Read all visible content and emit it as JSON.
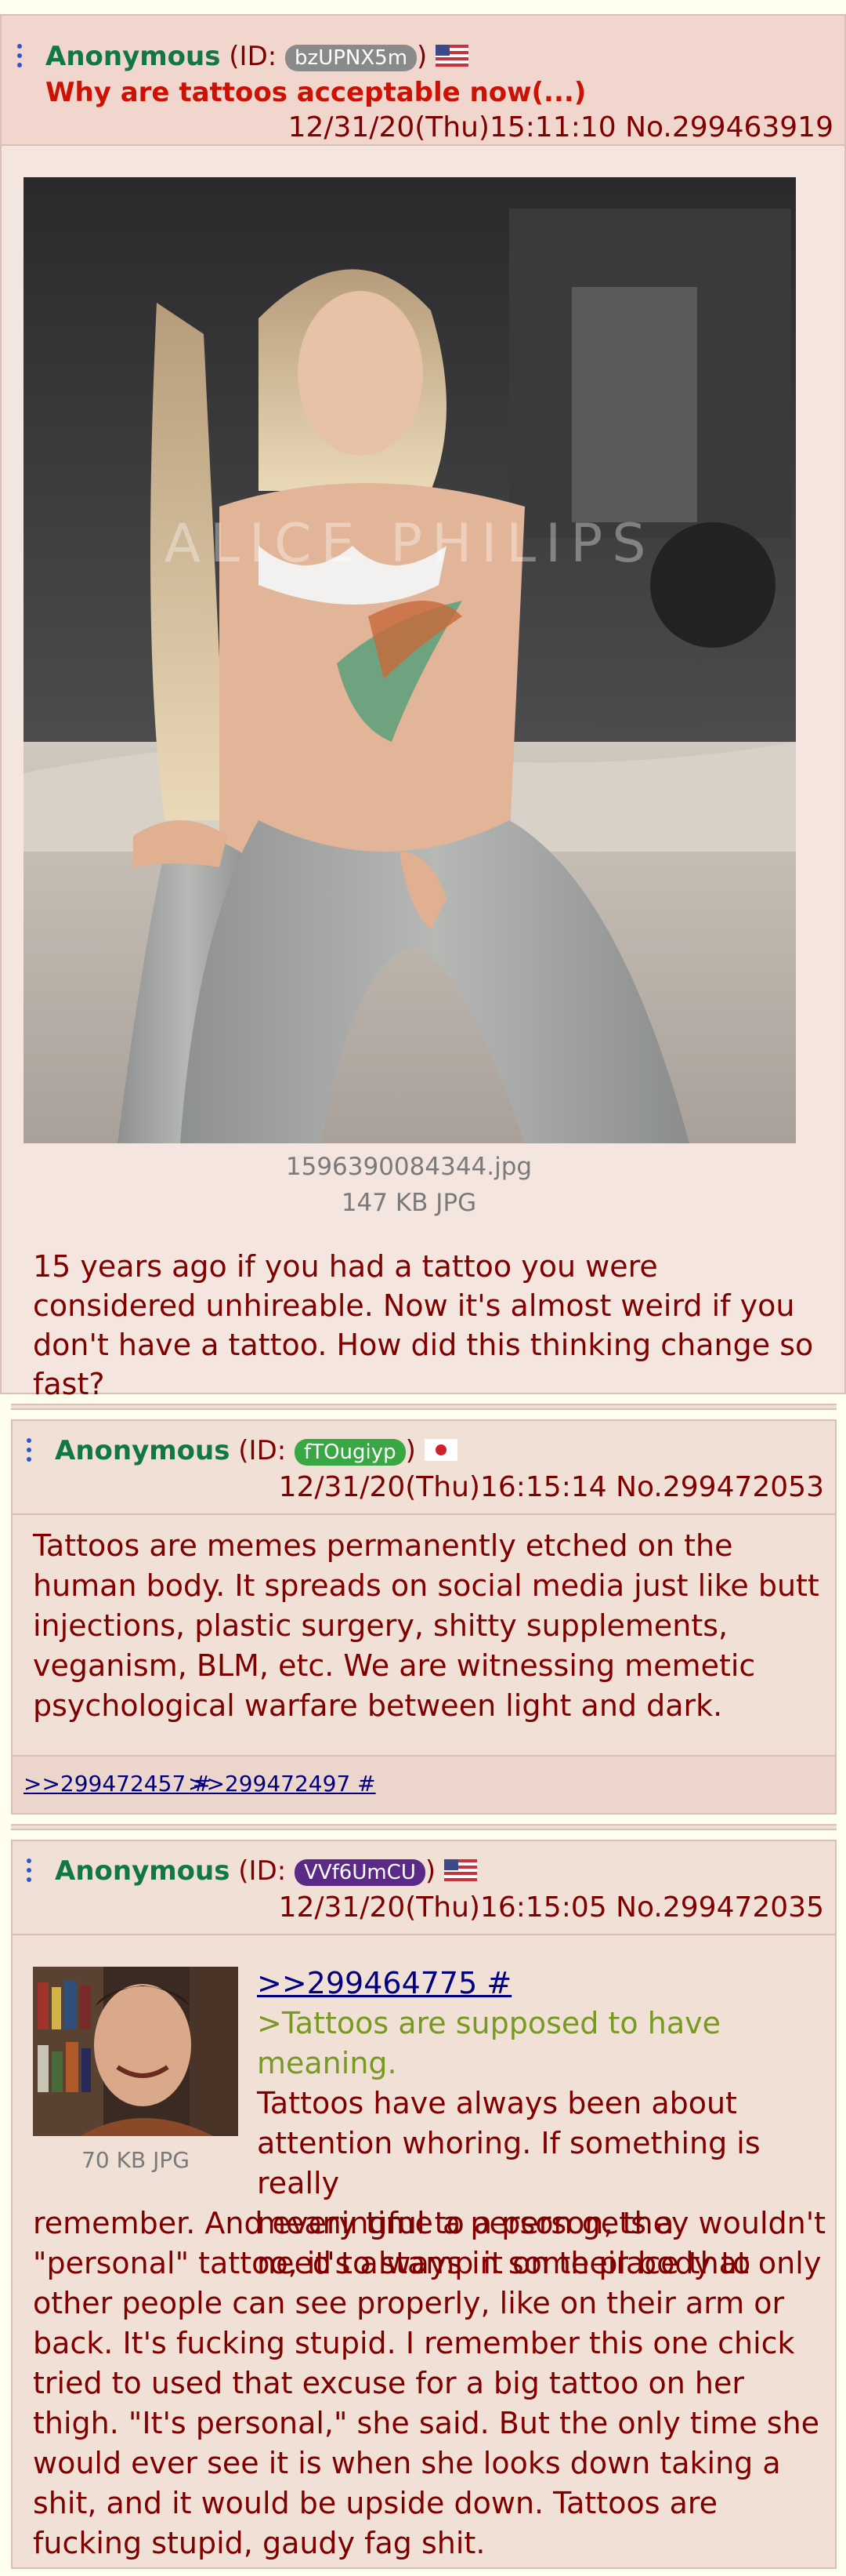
{
  "op": {
    "name": "Anonymous",
    "id_prefix": "(ID: ",
    "id": "bzUPNX5m",
    "id_suffix": ")",
    "flag": "US",
    "subject": "Why are tattoos acceptable now(...)",
    "datetime_no": "12/31/20(Thu)15:11:10 No.299463919",
    "image_watermark": "ALICE PHILIPS",
    "filename": "1596390084344.jpg",
    "filesize": "147 KB JPG",
    "comment": "15 years ago if you had a tattoo you were considered unhireable. Now it's almost weird if you don't have a tattoo. How did this thinking change so fast?"
  },
  "reply1": {
    "name": "Anonymous",
    "id_prefix": "(ID: ",
    "id": "fTOugiyp",
    "id_suffix": ")",
    "id_color": "#3aa745",
    "flag": "JP",
    "datetime_no": "12/31/20(Thu)16:15:14 No.299472053",
    "comment": "Tattoos are memes permanently etched on the human body. It spreads on social media just like butt injections, plastic surgery, shitty supplements, veganism, BLM, etc. We are witnessing memetic psychological warfare between light and dark.",
    "backlinks": [
      ">>299472457 #",
      ">>299472497 #"
    ]
  },
  "reply2": {
    "name": "Anonymous",
    "id_prefix": "(ID: ",
    "id": "VVf6UmCU",
    "id_suffix": ")",
    "id_color": "#5b2a86",
    "flag": "US",
    "datetime_no": "12/31/20(Thu)16:15:05 No.299472035",
    "filesize": "70 KB JPG",
    "quote_link": ">>299464775 #",
    "greentext": ">Tattoos are supposed to have meaning.",
    "comment_lines_beside": [
      "Tattoos have always been about",
      "attention whoring. If something is really",
      "meaningful to a person, they wouldn't",
      "need to stamp it on their body to"
    ],
    "comment_rest": "remember. And every time a person gets a \"personal\" tattoo, it's always in some place that only other people can see properly, like on their arm or back. It's fucking stupid. I remember this one chick tried to used that excuse for a big tattoo on her thigh. \"It's personal,\" she said. But the only time she would ever see it is when she looks down taking a shit, and it would be upside down. Tattoos are fucking stupid, gaudy fag shit."
  },
  "colors": {
    "name_green": "#117743",
    "subject_red": "#cc1105",
    "text_maroon": "#800000",
    "link_blue": "#000080",
    "greentext": "#789922",
    "op_id_badge": "#8a8a8a"
  }
}
